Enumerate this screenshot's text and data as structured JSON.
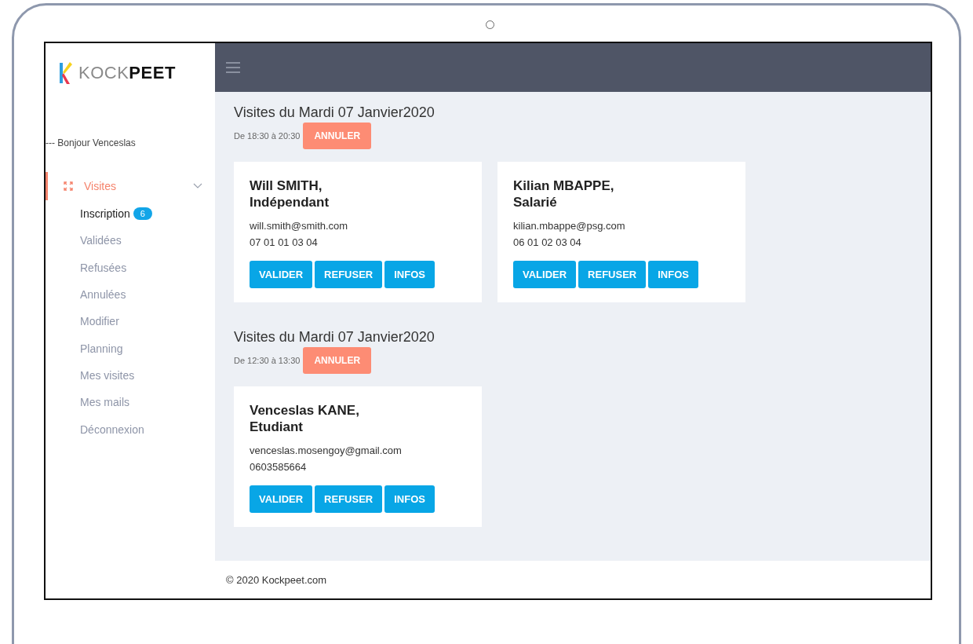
{
  "brand": {
    "light": "KOCK",
    "bold": "PEET"
  },
  "greeting": "--- Bonjour Venceslas",
  "nav": [
    {
      "label": "Visites",
      "selected": true,
      "expanded": true,
      "children": [
        {
          "label": "Inscription",
          "selected": true,
          "badge": "6"
        },
        {
          "label": "Validées",
          "selected": false
        },
        {
          "label": "Refusées",
          "selected": false
        },
        {
          "label": "Annulées",
          "selected": false
        },
        {
          "label": "Modifier",
          "selected": false
        },
        {
          "label": "Planning",
          "selected": false
        },
        {
          "label": "Mes visites",
          "selected": false
        },
        {
          "label": "Mes mails",
          "selected": false
        },
        {
          "label": "Déconnexion",
          "selected": false
        }
      ]
    }
  ],
  "visit_groups": [
    {
      "title": "Visites du Mardi 07 Janvier2020",
      "time": "De 18:30 à 20:30",
      "cancel": "ANNULER",
      "cards": [
        {
          "name": "Will SMITH,",
          "status": "Indépendant",
          "email": "will.smith@smith.com",
          "phone": "07 01 01 03 04",
          "buttons": [
            "VALIDER",
            "REFUSER",
            "INFOS"
          ]
        },
        {
          "name": "Kilian MBAPPE,",
          "status": "Salarié",
          "email": "kilian.mbappe@psg.com",
          "phone": "06 01 02 03 04",
          "buttons": [
            "VALIDER",
            "REFUSER",
            "INFOS"
          ]
        }
      ]
    },
    {
      "title": "Visites du Mardi 07 Janvier2020",
      "time": "De 12:30 à 13:30",
      "cancel": "ANNULER",
      "cards": [
        {
          "name": "Venceslas KANE,",
          "status": "Etudiant",
          "email": "venceslas.mosengoy@gmail.com",
          "phone": "0603585664",
          "buttons": [
            "VALIDER",
            "REFUSER",
            "INFOS"
          ]
        }
      ]
    }
  ],
  "footer": "© 2020 Kockpeet.com"
}
